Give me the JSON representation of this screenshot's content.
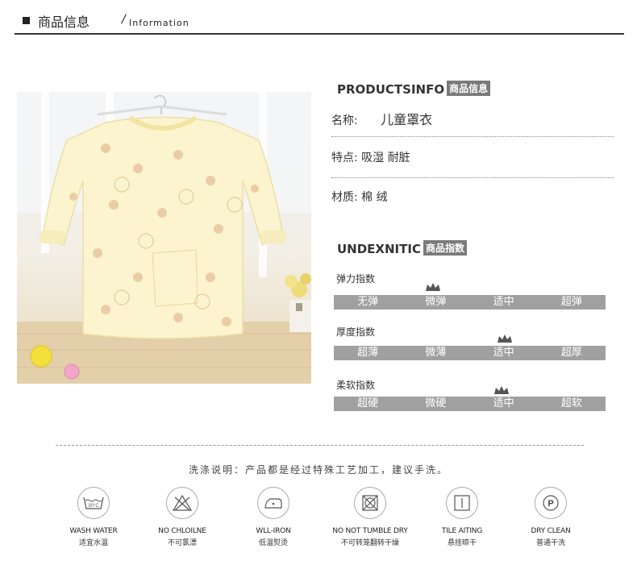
{
  "header": {
    "title_cn": "商品信息",
    "slash": "/",
    "title_en": "Information"
  },
  "productsinfo": {
    "heading": "PRODUCTSINFO",
    "tag": "商品信息",
    "rows": [
      {
        "label": "名称:",
        "value": "儿童罩衣"
      },
      {
        "label": "特点:",
        "value": "吸湿 耐脏"
      },
      {
        "label": "材质:",
        "value": "棉 绒"
      }
    ]
  },
  "index": {
    "heading": "UNDEXNITIC",
    "tag": "商品指数",
    "items": [
      {
        "label": "弹力指数",
        "options": [
          "无弹",
          "微弹",
          "适中",
          "超弹"
        ],
        "selected": 1
      },
      {
        "label": "厚度指数",
        "options": [
          "超薄",
          "微薄",
          "适中",
          "超厚"
        ],
        "selected": 2
      },
      {
        "label": "柔软指数",
        "options": [
          "超硬",
          "微硬",
          "适中",
          "超软"
        ],
        "selected": 2
      }
    ]
  },
  "washing": {
    "note": "洗涤说明：产品都是经过特殊工艺加工，建议手洗。",
    "items": [
      {
        "icon": "wash-water-icon",
        "en": "WASH WATER",
        "cn": "适宜水温",
        "badge": "30°C"
      },
      {
        "icon": "no-bleach-icon",
        "en": "NO CHLOILNE",
        "cn": "不可氯漂"
      },
      {
        "icon": "iron-icon",
        "en": "WLL-IRON",
        "cn": "低温熨烫"
      },
      {
        "icon": "no-tumble-dry-icon",
        "en": "NO NOT TUMBLE DRY",
        "cn": "不可转笼翻转干燥"
      },
      {
        "icon": "hang-dry-icon",
        "en": "TILE AITING",
        "cn": "悬挂晾干"
      },
      {
        "icon": "dry-clean-icon",
        "en": "DRY CLEAN",
        "cn": "普通干洗",
        "badge": "P"
      }
    ]
  },
  "colors": {
    "bar": "#a0a0a0",
    "tag": "#7a7a7a",
    "text": "#333333"
  }
}
